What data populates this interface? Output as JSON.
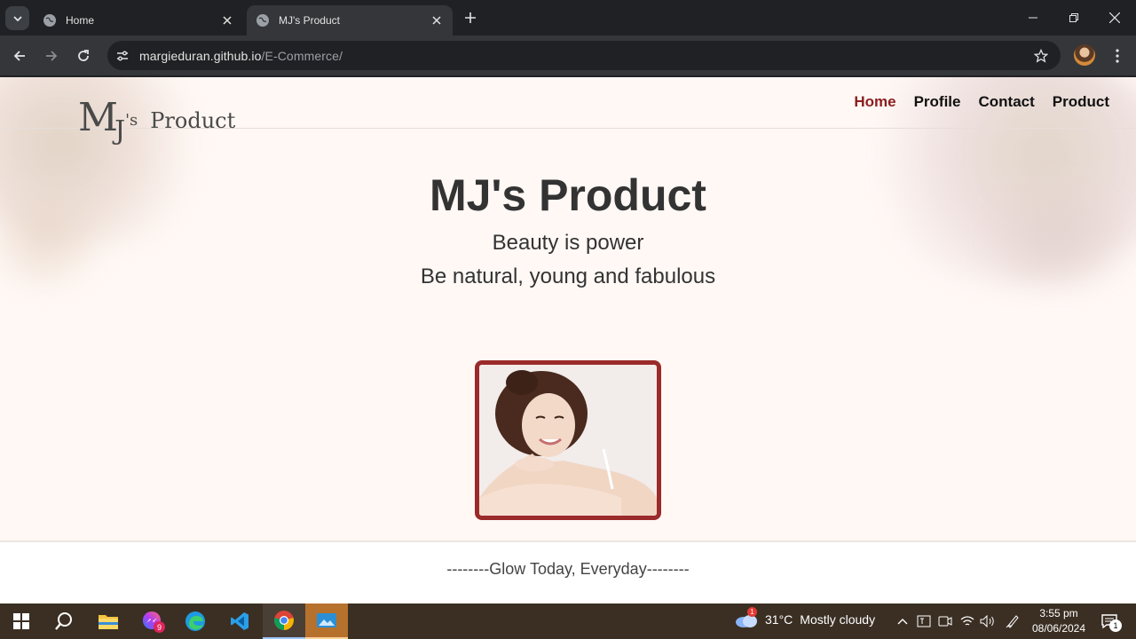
{
  "browser": {
    "tabs": [
      {
        "title": "Home",
        "active": false
      },
      {
        "title": "MJ's Product",
        "active": true
      }
    ],
    "url_host": "margieduran.github.io",
    "url_path": "/E-Commerce/"
  },
  "site": {
    "logo": {
      "m": "M",
      "j": "J",
      "s": "'s",
      "product": "Product"
    },
    "nav": [
      {
        "label": "Home",
        "active": true
      },
      {
        "label": "Profile",
        "active": false
      },
      {
        "label": "Contact",
        "active": false
      },
      {
        "label": "Product",
        "active": false
      }
    ],
    "hero": {
      "title": "MJ's Product",
      "subtitle1": "Beauty is power",
      "subtitle2": "Be natural, young and fabulous"
    },
    "footer": {
      "text": "--------Glow Today, Everyday--------"
    },
    "accent_color": "#8b1e1e",
    "frame_color": "#9b2a2a"
  },
  "taskbar": {
    "weather_temp": "31°C",
    "weather_desc": "Mostly cloudy",
    "weather_badge": "1",
    "chrome_badge": "9",
    "time": "3:55 pm",
    "date": "08/06/2024",
    "notifications": "1"
  }
}
